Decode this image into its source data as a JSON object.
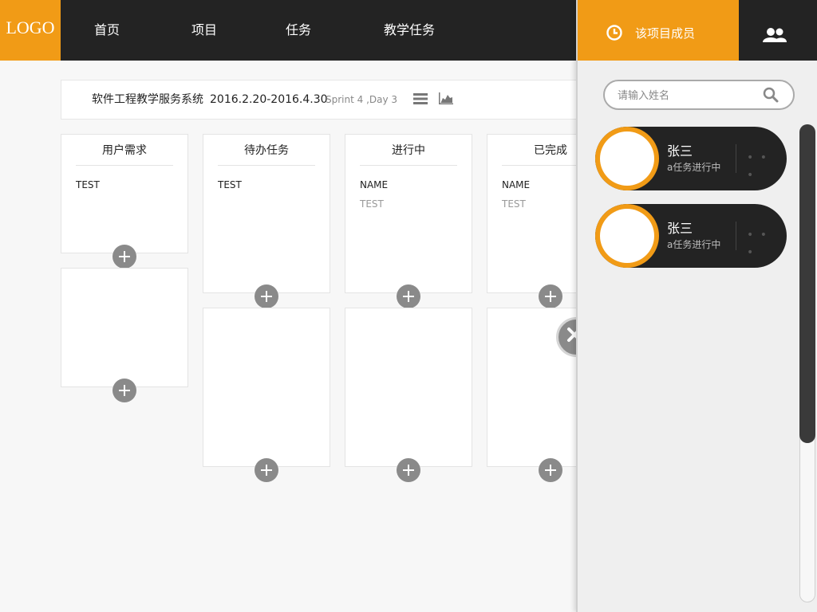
{
  "header": {
    "logo": "LOGO",
    "nav": [
      "首页",
      "项目",
      "任务",
      "教学任务"
    ]
  },
  "project": {
    "name": "软件工程教学服务系统",
    "dates": "2016.2.20-2016.4.30",
    "sprint": "Sprint 4 ,Day 3",
    "icons": [
      "list-icon",
      "chart-icon"
    ]
  },
  "board": {
    "columns": [
      {
        "title": "用户需求",
        "cards": [
          {
            "line1": "TEST",
            "line2": ""
          },
          {
            "line1": "",
            "line2": ""
          }
        ]
      },
      {
        "title": "待办任务",
        "cards": [
          {
            "line1": "TEST",
            "line2": ""
          },
          {
            "line1": "",
            "line2": ""
          }
        ]
      },
      {
        "title": "进行中",
        "cards": [
          {
            "line1": "NAME",
            "line2": "TEST"
          },
          {
            "line1": "",
            "line2": ""
          }
        ]
      },
      {
        "title": "已完成",
        "cards": [
          {
            "line1": "NAME",
            "line2": "TEST"
          },
          {
            "line1": "",
            "line2": ""
          }
        ]
      }
    ]
  },
  "panel": {
    "tab_label": "该项目成员",
    "tab_icon": "clock-icon",
    "users_icon": "users-icon",
    "search_placeholder": "请输入姓名",
    "members": [
      {
        "name": "张三",
        "status": "a任务进行中",
        "more": "• • •"
      },
      {
        "name": "张三",
        "status": "a任务进行中",
        "more": "• • •"
      }
    ]
  },
  "colors": {
    "accent": "#f19b16",
    "dark": "#232323",
    "background": "#f7f7f7",
    "button_gray": "#8a8a8a"
  }
}
